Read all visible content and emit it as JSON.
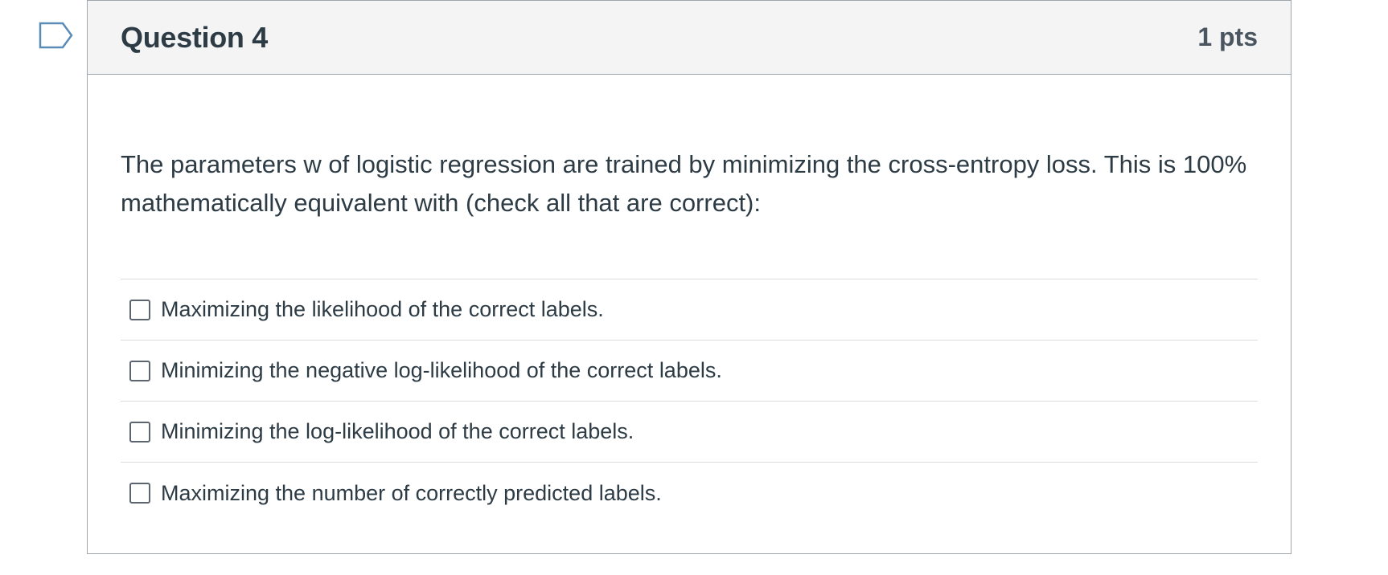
{
  "question": {
    "title": "Question 4",
    "points": "1 pts",
    "text": "The parameters w of logistic regression are trained by minimizing the cross-entropy loss. This is 100% mathematically equivalent with (check all that are correct):",
    "flag_icon": "bookmark-flag-icon",
    "answers": [
      {
        "label": "Maximizing the likelihood of the correct labels.",
        "checked": false
      },
      {
        "label": "Minimizing the negative log-likelihood of the correct labels.",
        "checked": false
      },
      {
        "label": "Minimizing the log-likelihood of the correct labels.",
        "checked": false
      },
      {
        "label": "Maximizing the number of correctly predicted labels.",
        "checked": false
      }
    ]
  },
  "colors": {
    "header_bg": "#f4f4f4",
    "border": "#9fa6ad",
    "text": "#2d3b45",
    "flag": "#5a8cb8"
  }
}
